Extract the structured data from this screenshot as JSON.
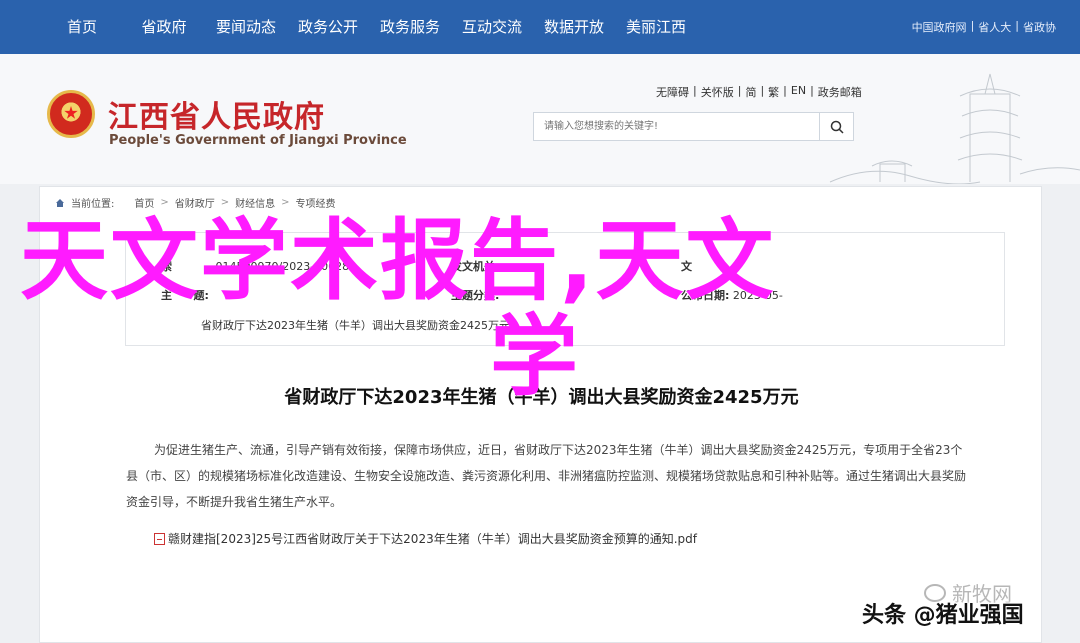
{
  "topnav": {
    "items": [
      "首页",
      "省政府",
      "要闻动态",
      "政务公开",
      "政务服务",
      "互动交流",
      "数据开放",
      "美丽江西"
    ],
    "right_links": [
      "中国政府网",
      "|",
      "省人大",
      "|",
      "省政协"
    ]
  },
  "header": {
    "title": "江西省人民政府",
    "subtitle": "People's Government of Jiangxi Province",
    "top_links": [
      "无障碍",
      "|",
      "关怀版",
      "|",
      "简",
      "|",
      "繁",
      "|",
      "EN",
      "|",
      "政务邮箱"
    ],
    "search_placeholder": "请输入您想搜索的关键字!"
  },
  "breadcrumb": {
    "label": "当前位置:",
    "items": [
      "首页",
      ">",
      "省财政厅",
      ">",
      "财经信息",
      ">",
      "专项经费"
    ]
  },
  "meta": {
    "index_label": "索",
    "index_value": "014500970/2023-00628",
    "issuer_label": "发文机关:",
    "issuer_value": "",
    "issuer_extra": "文",
    "subject_label": "主题分类:",
    "subject_value": "",
    "date_value": "2023-05-",
    "gen_label": "主",
    "gen_label2": "题:",
    "gen_value": "省财政厅下达2023年生猪（牛羊）调出大县奖励资金2425万元",
    "issue_label": "公布日期:",
    "issue_value": ""
  },
  "article": {
    "title": "省财政厅下达2023年生猪（牛羊）调出大县奖励资金2425万元",
    "body": "为促进生猪生产、流通，引导产销有效衔接，保障市场供应，近日，省财政厅下达2023年生猪（牛羊）调出大县奖励资金2425万元，专项用于全省23个县（市、区）的规模猪场标准化改造建设、生物安全设施改造、粪污资源化利用、非洲猪瘟防控监测、规模猪场贷款贴息和引种补贴等。通过生猪调出大县奖励资金引导，不断提升我省生猪生产水平。",
    "attachment": "赣财建指[2023]25号江西省财政厅关于下达2023年生猪（牛羊）调出大县奖励资金预算的通知.pdf"
  },
  "overlay": {
    "line1": "天文学术报告,天文",
    "line2": "学"
  },
  "watermark": {
    "source": "新牧网",
    "credit": "头条 @猪业强国"
  },
  "colors": {
    "nav_blue": "#2a62ad",
    "title_red": "#c6262a",
    "overlay_magenta": "#ff1bff"
  }
}
